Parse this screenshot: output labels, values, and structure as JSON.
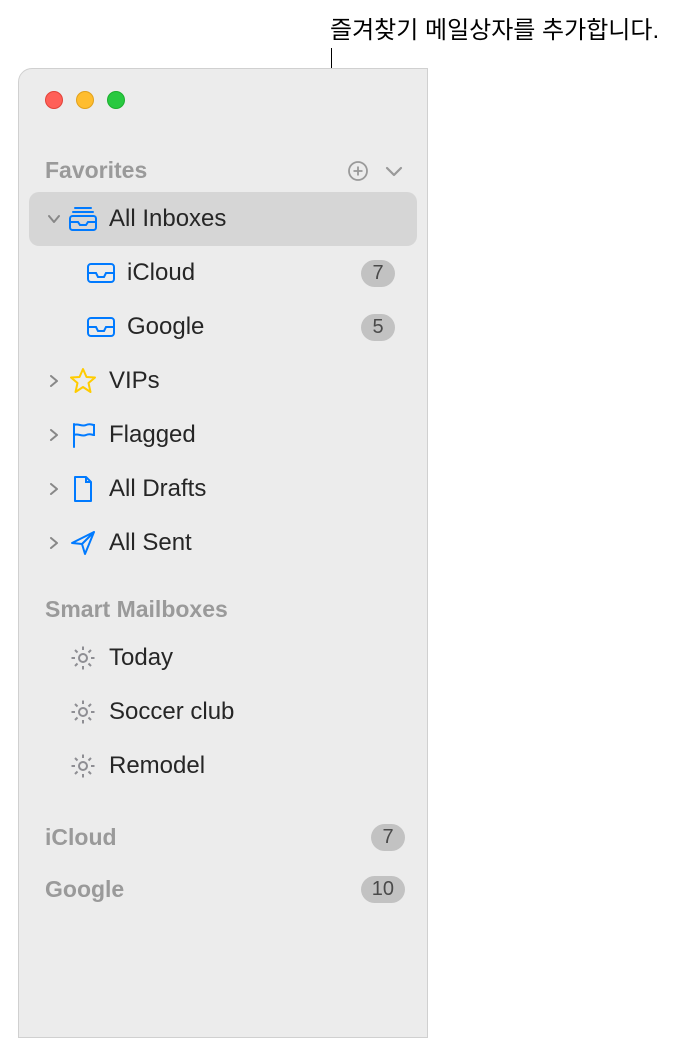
{
  "callout": "즐겨찾기 메일상자를 추가합니다.",
  "sections": {
    "favorites": {
      "title": "Favorites",
      "items": [
        {
          "label": "All Inboxes",
          "selected": true,
          "expanded": true
        },
        {
          "label": "iCloud",
          "badge": "7",
          "child": true
        },
        {
          "label": "Google",
          "badge": "5",
          "child": true
        },
        {
          "label": "VIPs",
          "collapsed": true
        },
        {
          "label": "Flagged",
          "collapsed": true
        },
        {
          "label": "All Drafts",
          "collapsed": true
        },
        {
          "label": "All Sent",
          "collapsed": true
        }
      ]
    },
    "smart": {
      "title": "Smart Mailboxes",
      "items": [
        {
          "label": "Today"
        },
        {
          "label": "Soccer club"
        },
        {
          "label": "Remodel"
        }
      ]
    },
    "accounts": [
      {
        "label": "iCloud",
        "badge": "7"
      },
      {
        "label": "Google",
        "badge": "10"
      }
    ]
  }
}
